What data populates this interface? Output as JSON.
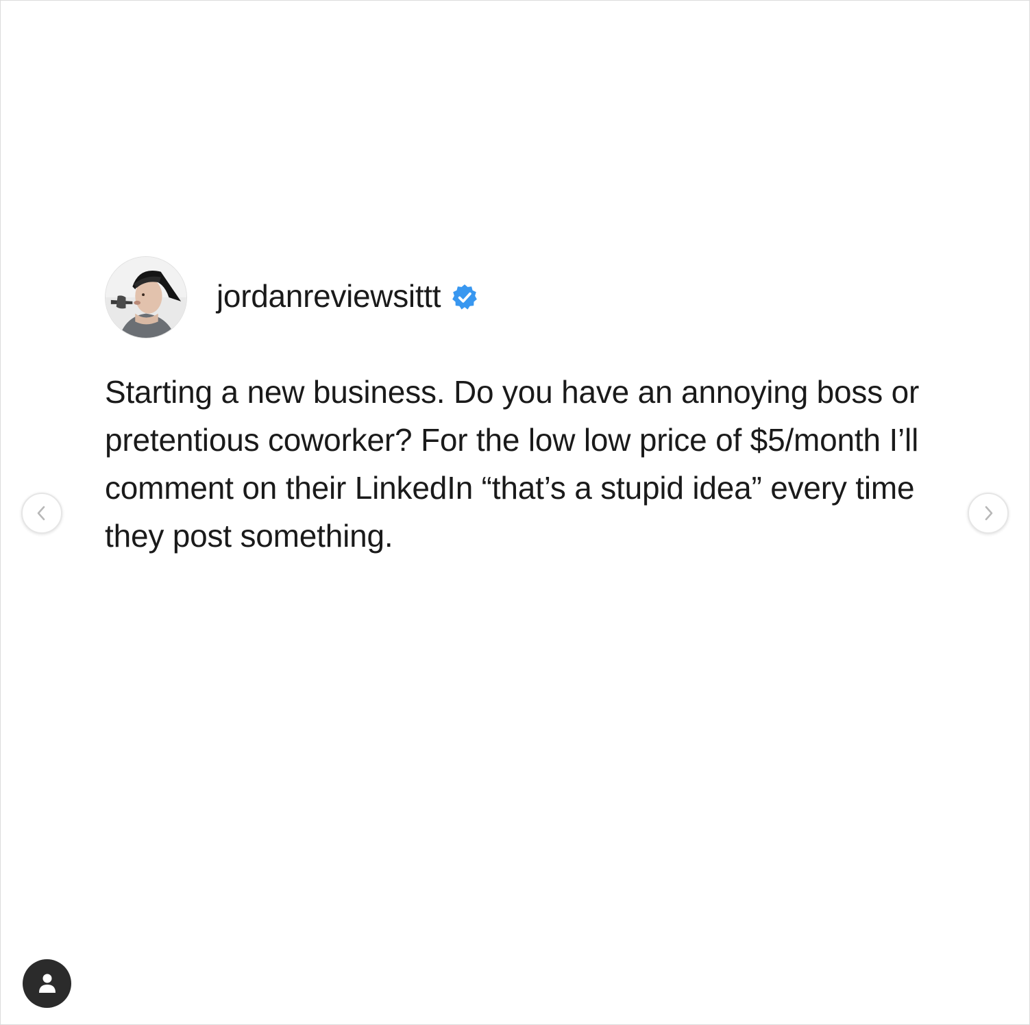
{
  "post": {
    "username": "jordanreviewsittt",
    "verified": true,
    "avatar_icon": "profile-photo",
    "text": "Starting a new business. Do you have an annoying boss or pretentious coworker? For the low low price of $5/month I’ll comment on their LinkedIn “that’s a stupid idea” every time they post something."
  },
  "carousel": {
    "prev_icon": "chevron-left-icon",
    "next_icon": "chevron-right-icon"
  },
  "tag_button": {
    "icon": "user-tag-icon"
  },
  "colors": {
    "verified_badge": "#3897f0",
    "text": "#1a1a1a",
    "tag_button_bg": "#2b2b2b",
    "border": "#dbdbdb"
  }
}
